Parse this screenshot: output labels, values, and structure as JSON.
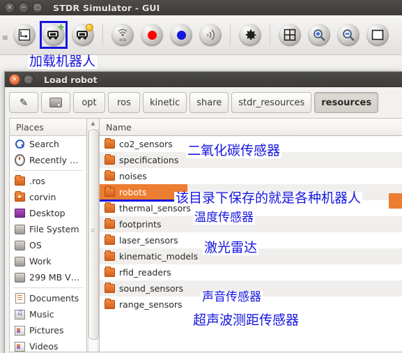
{
  "main_window": {
    "title": "STDR Simulator - GUI",
    "window_buttons": [
      {
        "name": "close",
        "glyph": "×"
      },
      {
        "name": "minimize",
        "glyph": "−"
      },
      {
        "name": "maximize",
        "glyph": "□"
      }
    ],
    "toolbar": {
      "items": [
        {
          "name": "load-map-button",
          "icon": "map-icon",
          "selected": false
        },
        {
          "name": "load-robot-button",
          "icon": "robot-add-icon",
          "selected": true
        },
        {
          "name": "robot-properties-button",
          "icon": "robot-edit-icon",
          "selected": false
        },
        {
          "name": "sonar-button",
          "icon": "rfid-wave-icon",
          "selected": false
        },
        {
          "name": "record-button",
          "icon": "red-dot-icon",
          "selected": false
        },
        {
          "name": "marker-button",
          "icon": "blue-dot-icon",
          "selected": false
        },
        {
          "name": "sound-button",
          "icon": "sound-wave-icon",
          "selected": false
        },
        {
          "name": "settings-button",
          "icon": "gear-icon",
          "selected": false
        },
        {
          "name": "grid-button",
          "icon": "grid-icon",
          "selected": false
        },
        {
          "name": "zoom-in-button",
          "icon": "zoom-in-icon",
          "selected": false
        },
        {
          "name": "zoom-out-button",
          "icon": "zoom-out-icon",
          "selected": false
        },
        {
          "name": "fit-button",
          "icon": "fit-screen-icon",
          "selected": false
        }
      ],
      "colors": {
        "red_dot": "#ff0000",
        "blue_dot": "#1515e0",
        "selection_outline": "#1515e0"
      }
    }
  },
  "dialog": {
    "title": "Load robot",
    "window_buttons": [
      {
        "name": "close",
        "glyph": "×"
      },
      {
        "name": "maximize",
        "glyph": "□"
      }
    ],
    "pathbar": {
      "edit_button_icon": "pencil-icon",
      "drive_button_icon": "hard-drive-icon",
      "crumbs": [
        {
          "label": "opt",
          "active": false
        },
        {
          "label": "ros",
          "active": false
        },
        {
          "label": "kinetic",
          "active": false
        },
        {
          "label": "share",
          "active": false
        },
        {
          "label": "stdr_resources",
          "active": false
        },
        {
          "label": "resources",
          "active": true
        }
      ]
    },
    "places": {
      "header": "Places",
      "groups": [
        [
          {
            "label": "Search",
            "icon": "search-icon"
          },
          {
            "label": "Recently …",
            "icon": "recent-clock-icon"
          }
        ],
        [
          {
            "label": ".ros",
            "icon": "folder-icon"
          },
          {
            "label": "corvin",
            "icon": "home-folder-icon"
          },
          {
            "label": "Desktop",
            "icon": "desktop-icon"
          },
          {
            "label": "File System",
            "icon": "drive-icon"
          },
          {
            "label": "OS",
            "icon": "drive-icon"
          },
          {
            "label": "Work",
            "icon": "drive-icon"
          },
          {
            "label": "299 MB V…",
            "icon": "drive-icon"
          }
        ],
        [
          {
            "label": "Documents",
            "icon": "documents-icon"
          },
          {
            "label": "Music",
            "icon": "music-icon"
          },
          {
            "label": "Pictures",
            "icon": "pictures-icon"
          },
          {
            "label": "Videos",
            "icon": "videos-icon"
          }
        ]
      ]
    },
    "filelist": {
      "column_header": "Name",
      "rows": [
        {
          "label": "co2_sensors",
          "icon": "folder-icon",
          "selected": false
        },
        {
          "label": "specifications",
          "icon": "folder-icon",
          "selected": false
        },
        {
          "label": "noises",
          "icon": "folder-icon",
          "selected": false
        },
        {
          "label": "robots",
          "icon": "folder-icon",
          "selected": true
        },
        {
          "label": "thermal_sensors",
          "icon": "folder-icon",
          "selected": false
        },
        {
          "label": "footprints",
          "icon": "folder-icon",
          "selected": false
        },
        {
          "label": "laser_sensors",
          "icon": "folder-icon",
          "selected": false
        },
        {
          "label": "kinematic_models",
          "icon": "folder-icon",
          "selected": false
        },
        {
          "label": "rfid_readers",
          "icon": "folder-icon",
          "selected": false
        },
        {
          "label": "sound_sensors",
          "icon": "folder-icon",
          "selected": false
        },
        {
          "label": "range_sensors",
          "icon": "folder-icon",
          "selected": false
        }
      ],
      "selection_color": "#ed7d31",
      "selection_underline_color": "#1515e0"
    }
  },
  "annotations": {
    "color": "#1515e0",
    "items": [
      {
        "name": "annotation-load-robot",
        "text": "加载机器人"
      },
      {
        "name": "annotation-co2-sensors",
        "text": "二氧化碳传感器"
      },
      {
        "name": "annotation-robots",
        "text": "该目录下保存的就是各种机器人"
      },
      {
        "name": "annotation-thermal-sensors",
        "text": "温度传感器"
      },
      {
        "name": "annotation-laser-sensors",
        "text": "激光雷达"
      },
      {
        "name": "annotation-sound-sensors",
        "text": "声音传感器"
      },
      {
        "name": "annotation-range-sensors",
        "text": "超声波测距传感器"
      }
    ]
  }
}
